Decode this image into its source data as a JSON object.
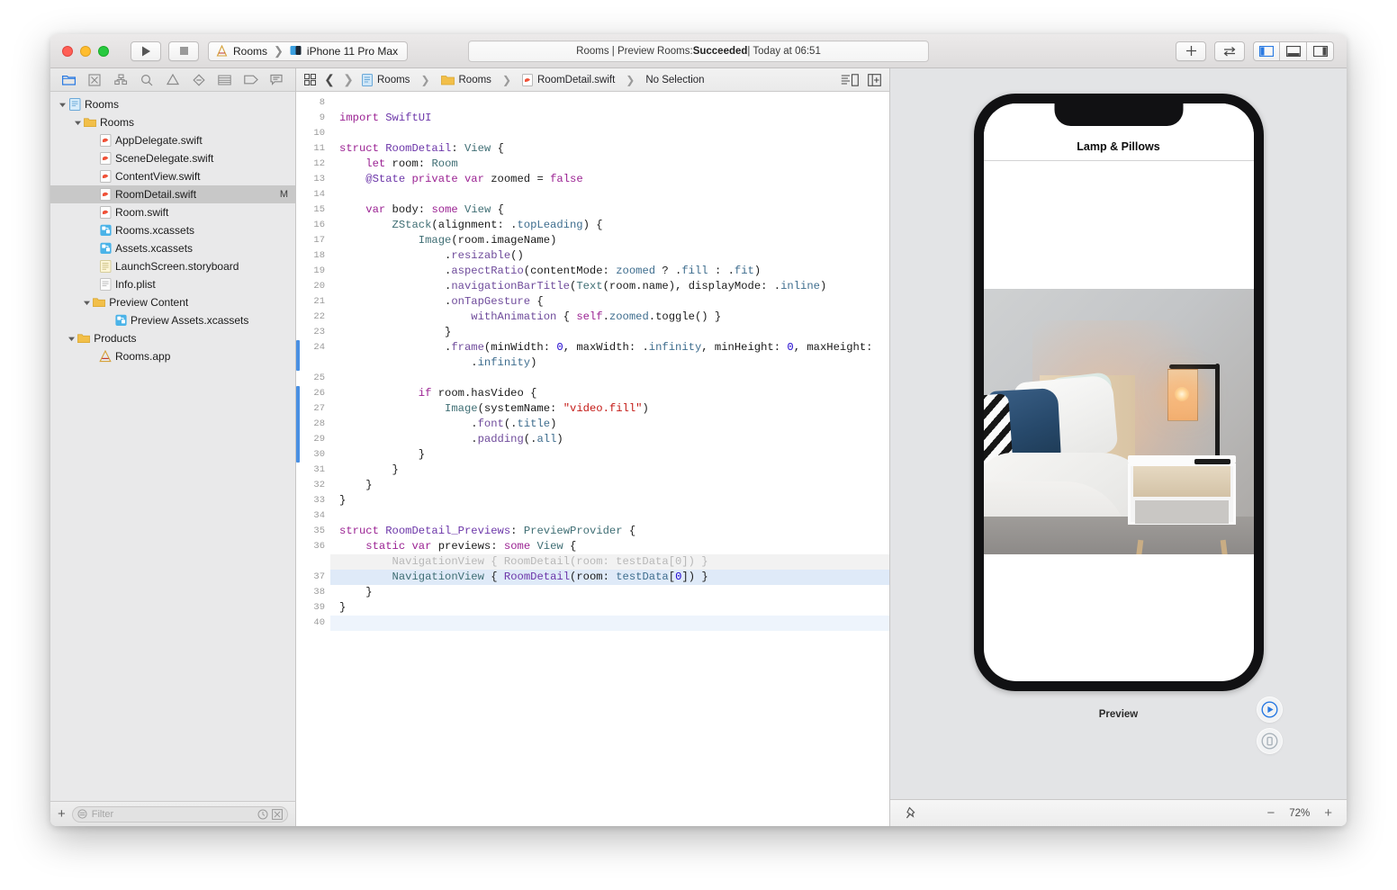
{
  "titlebar": {
    "run_icon": "play-icon",
    "stop_icon": "stop-icon",
    "scheme_name": "Rooms",
    "scheme_sep": "❯",
    "destination": "iPhone 11 Pro Max",
    "status_prefix": "Rooms | Preview Rooms: ",
    "status_result": "Succeeded",
    "status_suffix": " | Today at 06:51",
    "add_label": "+",
    "toggle_icon": "swap-arrows-icon",
    "panel_left_icon": "left-panel-icon",
    "panel_bottom_icon": "bottom-panel-icon",
    "panel_right_icon": "right-panel-icon"
  },
  "navigator": {
    "toolbar_icons": [
      "folder-icon",
      "source-control-icon",
      "symbol-hierarchy-icon",
      "search-icon",
      "warning-triangle-icon",
      "test-diamond-icon",
      "debug-list-icon",
      "breakpoint-tag-icon",
      "report-message-icon"
    ],
    "tree": [
      {
        "label": "Rooms",
        "depth": 0,
        "icon": "project-icon",
        "twisty": "down",
        "badge": ""
      },
      {
        "label": "Rooms",
        "depth": 1,
        "icon": "folder-icon",
        "twisty": "down",
        "badge": ""
      },
      {
        "label": "AppDelegate.swift",
        "depth": 2,
        "icon": "swift-file-icon",
        "twisty": "",
        "badge": ""
      },
      {
        "label": "SceneDelegate.swift",
        "depth": 2,
        "icon": "swift-file-icon",
        "twisty": "",
        "badge": ""
      },
      {
        "label": "ContentView.swift",
        "depth": 2,
        "icon": "swift-file-icon",
        "twisty": "",
        "badge": ""
      },
      {
        "label": "RoomDetail.swift",
        "depth": 2,
        "icon": "swift-file-icon",
        "twisty": "",
        "badge": "M",
        "selected": true
      },
      {
        "label": "Room.swift",
        "depth": 2,
        "icon": "swift-file-icon",
        "twisty": "",
        "badge": ""
      },
      {
        "label": "Rooms.xcassets",
        "depth": 2,
        "icon": "assets-icon",
        "twisty": "",
        "badge": ""
      },
      {
        "label": "Assets.xcassets",
        "depth": 2,
        "icon": "assets-icon",
        "twisty": "",
        "badge": ""
      },
      {
        "label": "LaunchScreen.storyboard",
        "depth": 2,
        "icon": "storyboard-icon",
        "twisty": "",
        "badge": ""
      },
      {
        "label": "Info.plist",
        "depth": 2,
        "icon": "plist-icon",
        "twisty": "",
        "badge": ""
      },
      {
        "label": "Preview Content",
        "depth": 1.6,
        "icon": "folder-icon",
        "twisty": "down",
        "badge": ""
      },
      {
        "label": "Preview Assets.xcassets",
        "depth": 3,
        "icon": "assets-icon",
        "twisty": "",
        "badge": ""
      },
      {
        "label": "Products",
        "depth": 0.6,
        "icon": "folder-icon",
        "twisty": "down",
        "badge": ""
      },
      {
        "label": "Rooms.app",
        "depth": 2,
        "icon": "app-icon",
        "twisty": "",
        "badge": ""
      }
    ],
    "add_button": "+",
    "filter_placeholder": "Filter",
    "filter_value": "",
    "filter_icon": "filter-funnel-icon",
    "recent_icon": "clock-icon",
    "scm_icon": "source-control-filter-icon"
  },
  "jumpbar": {
    "related_icon": "related-items-icon",
    "back_icon": "chevron-left-icon",
    "forward_icon": "chevron-right-icon",
    "crumbs": [
      {
        "label": "Rooms",
        "icon": "project-icon"
      },
      {
        "label": "Rooms",
        "icon": "folder-icon"
      },
      {
        "label": "RoomDetail.swift",
        "icon": "swift-file-icon"
      },
      {
        "label": "No Selection",
        "icon": ""
      }
    ],
    "separator": "❯",
    "minimap_icon": "minimap-icon",
    "add-editor_icon": "add-editor-icon"
  },
  "editor": {
    "first_line": 8,
    "lines": [
      {
        "n": 8,
        "tokens": []
      },
      {
        "n": 9,
        "tokens": [
          {
            "t": "import ",
            "c": "kw"
          },
          {
            "t": "SwiftUI",
            "c": "typ2"
          }
        ]
      },
      {
        "n": 10,
        "tokens": []
      },
      {
        "n": 11,
        "tokens": [
          {
            "t": "struct ",
            "c": "kw"
          },
          {
            "t": "RoomDetail",
            "c": "typ2"
          },
          {
            "t": ": ",
            "c": "plain"
          },
          {
            "t": "View",
            "c": "typ"
          },
          {
            "t": " {",
            "c": "plain"
          }
        ]
      },
      {
        "n": 12,
        "tokens": [
          {
            "t": "    ",
            "c": "plain"
          },
          {
            "t": "let ",
            "c": "kw"
          },
          {
            "t": "room",
            "c": "plain"
          },
          {
            "t": ": ",
            "c": "plain"
          },
          {
            "t": "Room",
            "c": "typ"
          }
        ]
      },
      {
        "n": 13,
        "tokens": [
          {
            "t": "    ",
            "c": "plain"
          },
          {
            "t": "@State ",
            "c": "typ2"
          },
          {
            "t": "private var ",
            "c": "kw"
          },
          {
            "t": "zoomed",
            "c": "plain"
          },
          {
            "t": " = ",
            "c": "plain"
          },
          {
            "t": "false",
            "c": "kw"
          }
        ]
      },
      {
        "n": 14,
        "tokens": []
      },
      {
        "n": 15,
        "tokens": [
          {
            "t": "    ",
            "c": "plain"
          },
          {
            "t": "var ",
            "c": "kw"
          },
          {
            "t": "body",
            "c": "plain"
          },
          {
            "t": ": ",
            "c": "plain"
          },
          {
            "t": "some ",
            "c": "kw"
          },
          {
            "t": "View",
            "c": "typ"
          },
          {
            "t": " {",
            "c": "plain"
          }
        ]
      },
      {
        "n": 16,
        "tokens": [
          {
            "t": "        ",
            "c": "plain"
          },
          {
            "t": "ZStack",
            "c": "typ"
          },
          {
            "t": "(alignment: .",
            "c": "plain"
          },
          {
            "t": "topLeading",
            "c": "mem"
          },
          {
            "t": ") {",
            "c": "plain"
          }
        ]
      },
      {
        "n": 17,
        "tokens": [
          {
            "t": "            ",
            "c": "plain"
          },
          {
            "t": "Image",
            "c": "typ"
          },
          {
            "t": "(room.",
            "c": "plain"
          },
          {
            "t": "imageName",
            "c": "plain"
          },
          {
            "t": ")",
            "c": "plain"
          }
        ]
      },
      {
        "n": 18,
        "tokens": [
          {
            "t": "                .",
            "c": "plain"
          },
          {
            "t": "resizable",
            "c": "prop"
          },
          {
            "t": "()",
            "c": "plain"
          }
        ]
      },
      {
        "n": 19,
        "tokens": [
          {
            "t": "                .",
            "c": "plain"
          },
          {
            "t": "aspectRatio",
            "c": "prop"
          },
          {
            "t": "(contentMode: ",
            "c": "plain"
          },
          {
            "t": "zoomed",
            "c": "mem"
          },
          {
            "t": " ? .",
            "c": "plain"
          },
          {
            "t": "fill",
            "c": "mem"
          },
          {
            "t": " : .",
            "c": "plain"
          },
          {
            "t": "fit",
            "c": "mem"
          },
          {
            "t": ")",
            "c": "plain"
          }
        ]
      },
      {
        "n": 20,
        "tokens": [
          {
            "t": "                .",
            "c": "plain"
          },
          {
            "t": "navigationBarTitle",
            "c": "prop"
          },
          {
            "t": "(",
            "c": "plain"
          },
          {
            "t": "Text",
            "c": "typ"
          },
          {
            "t": "(room.",
            "c": "plain"
          },
          {
            "t": "name",
            "c": "plain"
          },
          {
            "t": "), displayMode: .",
            "c": "plain"
          },
          {
            "t": "inline",
            "c": "mem"
          },
          {
            "t": ")",
            "c": "plain"
          }
        ]
      },
      {
        "n": 21,
        "tokens": [
          {
            "t": "                .",
            "c": "plain"
          },
          {
            "t": "onTapGesture",
            "c": "prop"
          },
          {
            "t": " {",
            "c": "plain"
          }
        ]
      },
      {
        "n": 22,
        "tokens": [
          {
            "t": "                    ",
            "c": "plain"
          },
          {
            "t": "withAnimation",
            "c": "prop"
          },
          {
            "t": " { ",
            "c": "plain"
          },
          {
            "t": "self",
            "c": "kw"
          },
          {
            "t": ".",
            "c": "plain"
          },
          {
            "t": "zoomed",
            "c": "mem"
          },
          {
            "t": ".toggle() }",
            "c": "plain"
          }
        ]
      },
      {
        "n": 23,
        "tokens": [
          {
            "t": "                }",
            "c": "plain"
          }
        ]
      },
      {
        "n": 24,
        "tokens": [
          {
            "t": "                .",
            "c": "plain"
          },
          {
            "t": "frame",
            "c": "prop"
          },
          {
            "t": "(minWidth: ",
            "c": "plain"
          },
          {
            "t": "0",
            "c": "num"
          },
          {
            "t": ", maxWidth: .",
            "c": "plain"
          },
          {
            "t": "infinity",
            "c": "mem"
          },
          {
            "t": ", minHeight: ",
            "c": "plain"
          },
          {
            "t": "0",
            "c": "num"
          },
          {
            "t": ", maxHeight:",
            "c": "plain"
          }
        ],
        "changed": true
      },
      {
        "n": "",
        "tokens": [
          {
            "t": "                    .",
            "c": "plain"
          },
          {
            "t": "infinity",
            "c": "mem"
          },
          {
            "t": ")",
            "c": "plain"
          }
        ],
        "changed": true,
        "continuation": true
      },
      {
        "n": 25,
        "tokens": []
      },
      {
        "n": 26,
        "tokens": [
          {
            "t": "            ",
            "c": "plain"
          },
          {
            "t": "if ",
            "c": "kw"
          },
          {
            "t": "room.",
            "c": "plain"
          },
          {
            "t": "hasVideo",
            "c": "plain"
          },
          {
            "t": " {",
            "c": "plain"
          }
        ],
        "changed": true
      },
      {
        "n": 27,
        "tokens": [
          {
            "t": "                ",
            "c": "plain"
          },
          {
            "t": "Image",
            "c": "typ"
          },
          {
            "t": "(systemName: ",
            "c": "plain"
          },
          {
            "t": "\"video.fill\"",
            "c": "str"
          },
          {
            "t": ")",
            "c": "plain"
          }
        ],
        "changed": true
      },
      {
        "n": 28,
        "tokens": [
          {
            "t": "                    .",
            "c": "plain"
          },
          {
            "t": "font",
            "c": "prop"
          },
          {
            "t": "(.",
            "c": "plain"
          },
          {
            "t": "title",
            "c": "mem"
          },
          {
            "t": ")",
            "c": "plain"
          }
        ],
        "changed": true
      },
      {
        "n": 29,
        "tokens": [
          {
            "t": "                    .",
            "c": "plain"
          },
          {
            "t": "padding",
            "c": "prop"
          },
          {
            "t": "(.",
            "c": "plain"
          },
          {
            "t": "all",
            "c": "mem"
          },
          {
            "t": ")",
            "c": "plain"
          }
        ],
        "changed": true
      },
      {
        "n": 30,
        "tokens": [
          {
            "t": "            }",
            "c": "plain"
          }
        ],
        "changed": true
      },
      {
        "n": 31,
        "tokens": [
          {
            "t": "        }",
            "c": "plain"
          }
        ]
      },
      {
        "n": 32,
        "tokens": [
          {
            "t": "    }",
            "c": "plain"
          }
        ]
      },
      {
        "n": 33,
        "tokens": [
          {
            "t": "}",
            "c": "plain"
          }
        ]
      },
      {
        "n": 34,
        "tokens": []
      },
      {
        "n": 35,
        "tokens": [
          {
            "t": "struct ",
            "c": "kw"
          },
          {
            "t": "RoomDetail_Previews",
            "c": "typ2"
          },
          {
            "t": ": ",
            "c": "plain"
          },
          {
            "t": "PreviewProvider",
            "c": "typ"
          },
          {
            "t": " {",
            "c": "plain"
          }
        ]
      },
      {
        "n": 36,
        "tokens": [
          {
            "t": "    ",
            "c": "plain"
          },
          {
            "t": "static var ",
            "c": "kw"
          },
          {
            "t": "previews",
            "c": "plain"
          },
          {
            "t": ": ",
            "c": "plain"
          },
          {
            "t": "some ",
            "c": "kw"
          },
          {
            "t": "View",
            "c": "typ"
          },
          {
            "t": " {",
            "c": "plain"
          }
        ]
      },
      {
        "n": "",
        "tokens": [
          {
            "t": "        NavigationView { RoomDetail(room: testData[0]) }",
            "c": "gray"
          }
        ],
        "ghost": true
      },
      {
        "n": 37,
        "tokens": [
          {
            "t": "        ",
            "c": "plain"
          },
          {
            "t": "NavigationView",
            "c": "typ"
          },
          {
            "t": " { ",
            "c": "plain"
          },
          {
            "t": "RoomDetail",
            "c": "typ2"
          },
          {
            "t": "(room: ",
            "c": "plain"
          },
          {
            "t": "testData",
            "c": "mem"
          },
          {
            "t": "[",
            "c": "plain"
          },
          {
            "t": "0",
            "c": "num"
          },
          {
            "t": "]) }",
            "c": "plain"
          }
        ],
        "highlight": true
      },
      {
        "n": 38,
        "tokens": [
          {
            "t": "    }",
            "c": "plain"
          }
        ]
      },
      {
        "n": 39,
        "tokens": [
          {
            "t": "}",
            "c": "plain"
          }
        ]
      },
      {
        "n": 40,
        "tokens": [],
        "highlight2": true
      }
    ]
  },
  "canvas": {
    "preview_label": "Preview",
    "device_title": "Lamp & Pillows",
    "live_preview_icon": "play-circle-icon",
    "inspect_device_icon": "device-circle-icon",
    "pin_icon": "pin-icon",
    "zoom_out": "−",
    "zoom_level": "72%",
    "zoom_in": "+"
  },
  "colors": {
    "accent_blue": "#4a90e2",
    "keyword_magenta": "#9b2393",
    "string_red": "#c41a16",
    "selection_blue": "#dfeaf8",
    "canvas_bg": "#e3e4e6"
  }
}
